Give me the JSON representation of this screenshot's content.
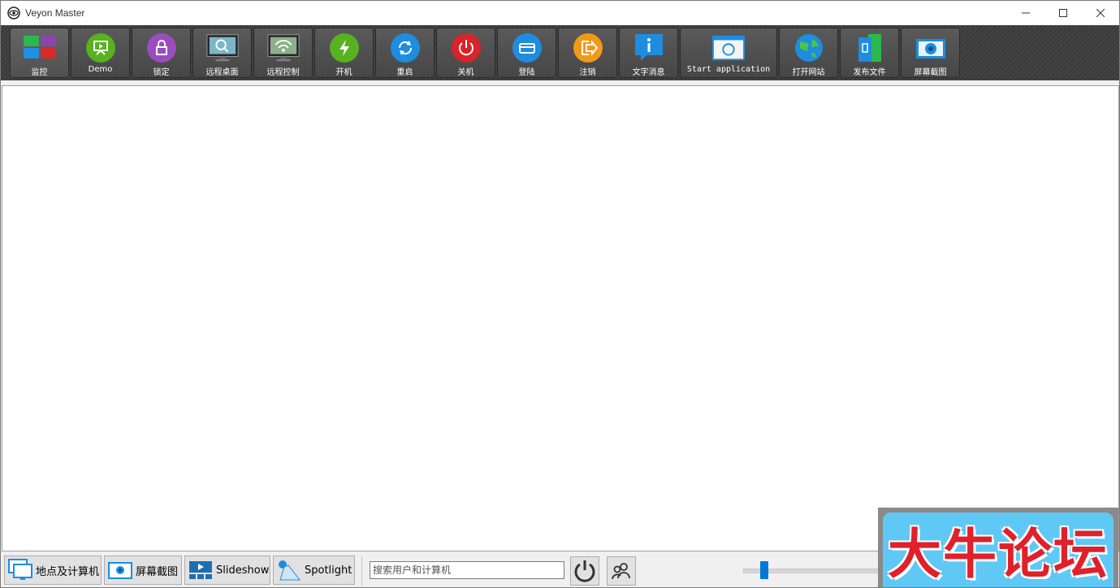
{
  "window": {
    "title": "Veyon Master"
  },
  "toolbar": {
    "items": [
      {
        "label": "监控",
        "icon": "monitoring-icon"
      },
      {
        "label": "Demo",
        "icon": "demo-icon"
      },
      {
        "label": "锁定",
        "icon": "lock-icon"
      },
      {
        "label": "远程桌面",
        "icon": "remote-view-icon"
      },
      {
        "label": "远程控制",
        "icon": "remote-control-icon"
      },
      {
        "label": "开机",
        "icon": "power-on-icon"
      },
      {
        "label": "重启",
        "icon": "reboot-icon"
      },
      {
        "label": "关机",
        "icon": "power-off-icon"
      },
      {
        "label": "登陆",
        "icon": "login-icon"
      },
      {
        "label": "注销",
        "icon": "logout-icon"
      },
      {
        "label": "文字消息",
        "icon": "text-message-icon"
      },
      {
        "label": "Start application",
        "icon": "start-application-icon"
      },
      {
        "label": "打开网站",
        "icon": "open-website-icon"
      },
      {
        "label": "发布文件",
        "icon": "file-transfer-icon"
      },
      {
        "label": "屏幕截图",
        "icon": "screenshot-icon"
      }
    ]
  },
  "statusbar": {
    "locations_label": "地点及计算机",
    "screenshots_label": "屏幕截图",
    "slideshow_label": "Slideshow",
    "spotlight_label": "Spotlight",
    "search_placeholder": "搜索用户和计算机",
    "zoom_fraction": 0.15
  },
  "watermark": {
    "text": "大牛论坛"
  },
  "colors": {
    "toolbar_bg": "#3d3d3d",
    "accent": "#0078d7",
    "watermark_bg": "#5fc8f5",
    "watermark_text": "#e0202a"
  }
}
